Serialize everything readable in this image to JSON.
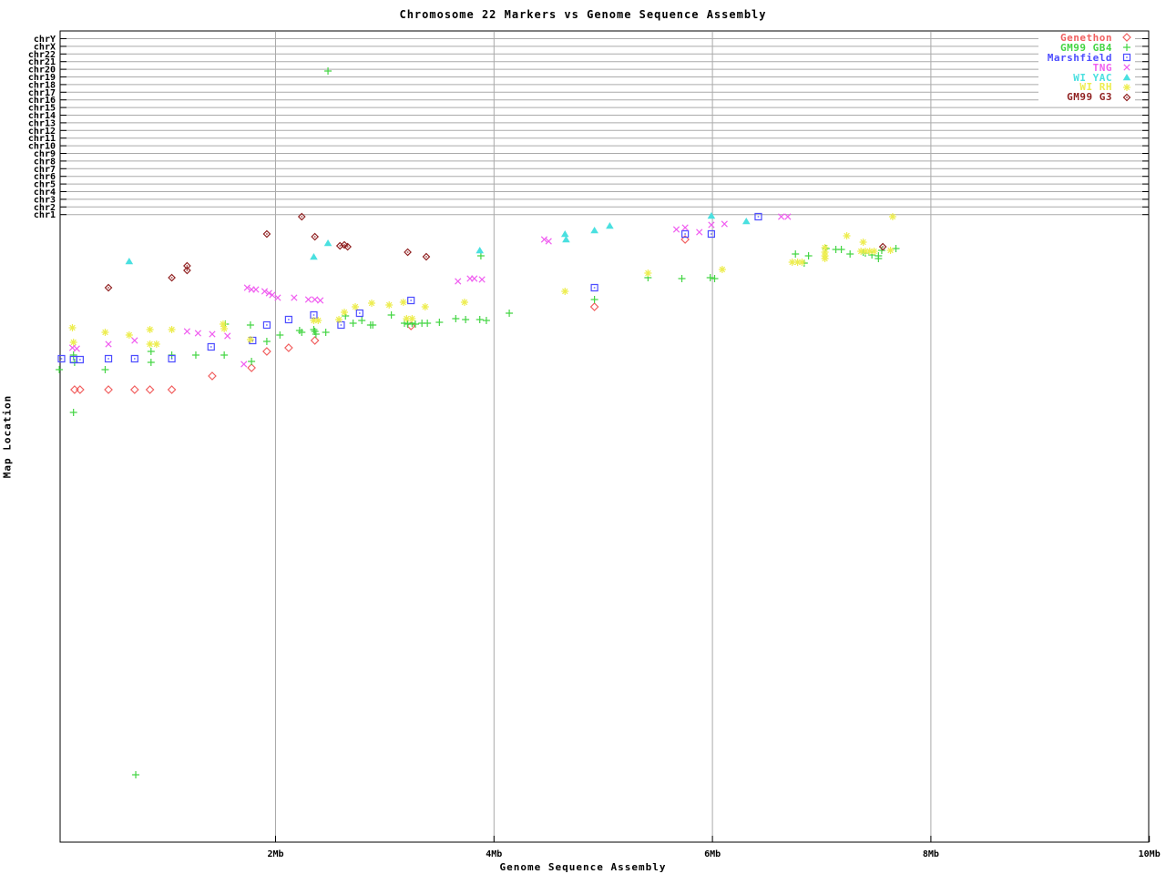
{
  "title": "Chromosome 22 Markers vs Genome Sequence Assembly",
  "x_axis": {
    "label": "Genome Sequence Assembly",
    "tick_labels": [
      "2Mb",
      "4Mb",
      "6Mb",
      "8Mb",
      "10Mb"
    ],
    "tick_values": [
      2,
      4,
      6,
      8,
      10
    ],
    "range_mb": [
      0,
      10
    ]
  },
  "y_axis": {
    "label": "Map Location",
    "categories": [
      "chrY",
      "chrX",
      "chr22",
      "chr21",
      "chr20",
      "chr19",
      "chr18",
      "chr17",
      "chr16",
      "chr15",
      "chr14",
      "chr13",
      "chr12",
      "chr11",
      "chr10",
      "chr9",
      "chr8",
      "chr7",
      "chr6",
      "chr5",
      "chr4",
      "chr3",
      "chr2",
      "chr1"
    ]
  },
  "colors": {
    "grid": "#aaaaaa",
    "frame": "#000000",
    "background": "#ffffff"
  },
  "chart_data": {
    "type": "scatter",
    "title": "Chromosome 22 Markers vs Genome Sequence Assembly",
    "xlabel": "Genome Sequence Assembly",
    "ylabel": "Map Location",
    "xlim_mb": [
      0,
      10
    ],
    "x_ticks": [
      "2Mb",
      "4Mb",
      "6Mb",
      "8Mb",
      "10Mb"
    ],
    "y_categories": [
      "chrY",
      "chrX",
      "chr22",
      "chr21",
      "chr20",
      "chr19",
      "chr18",
      "chr17",
      "chr16",
      "chr15",
      "chr14",
      "chr13",
      "chr12",
      "chr11",
      "chr10",
      "chr9",
      "chr8",
      "chr7",
      "chr6",
      "chr5",
      "chr4",
      "chr3",
      "chr2",
      "chr1"
    ],
    "grid": true,
    "legend_position": "top-right",
    "y_note": "x in Mb read from axis; y is vertical screen position (map-location axis shows only chromosome ticks at top, chr1 line = 236)",
    "series": [
      {
        "name": "Genethon",
        "color": "#f15f5f",
        "marker": "open-diamond",
        "points": [
          [
            0.16,
            428
          ],
          [
            0.21,
            428
          ],
          [
            0.47,
            428
          ],
          [
            0.71,
            428
          ],
          [
            0.85,
            428
          ],
          [
            1.05,
            428
          ],
          [
            1.42,
            413
          ],
          [
            1.78,
            404
          ],
          [
            1.92,
            386
          ],
          [
            2.12,
            382
          ],
          [
            2.36,
            374
          ],
          [
            3.24,
            358
          ],
          [
            4.92,
            337
          ],
          [
            5.75,
            263
          ]
        ]
      },
      {
        "name": "GM99 GB4",
        "color": "#44d544",
        "marker": "plus",
        "points": [
          [
            2.48,
            78
          ],
          [
            0.72,
            851
          ],
          [
            0.02,
            406
          ],
          [
            0.15,
            390
          ],
          [
            0.16,
            398
          ],
          [
            0.15,
            453
          ],
          [
            0.44,
            406
          ],
          [
            0.86,
            386
          ],
          [
            0.86,
            398
          ],
          [
            1.05,
            390
          ],
          [
            1.27,
            390
          ],
          [
            1.53,
            390
          ],
          [
            1.54,
            356
          ],
          [
            1.77,
            357
          ],
          [
            1.78,
            397
          ],
          [
            1.92,
            375
          ],
          [
            2.04,
            368
          ],
          [
            2.22,
            363
          ],
          [
            2.24,
            365
          ],
          [
            2.35,
            362
          ],
          [
            2.36,
            364
          ],
          [
            2.37,
            367
          ],
          [
            2.46,
            365
          ],
          [
            2.64,
            347
          ],
          [
            2.71,
            355
          ],
          [
            2.79,
            352
          ],
          [
            2.87,
            357
          ],
          [
            2.89,
            357
          ],
          [
            3.06,
            346
          ],
          [
            3.18,
            355
          ],
          [
            3.21,
            356
          ],
          [
            3.25,
            355
          ],
          [
            3.28,
            356
          ],
          [
            3.34,
            355
          ],
          [
            3.39,
            355
          ],
          [
            3.5,
            354
          ],
          [
            3.65,
            350
          ],
          [
            3.74,
            351
          ],
          [
            3.87,
            351
          ],
          [
            3.93,
            352
          ],
          [
            4.14,
            344
          ],
          [
            3.88,
            281
          ],
          [
            4.92,
            329
          ],
          [
            5.41,
            305
          ],
          [
            5.72,
            306
          ],
          [
            5.98,
            305
          ],
          [
            6.02,
            306
          ],
          [
            6.76,
            279
          ],
          [
            6.84,
            289
          ],
          [
            6.88,
            281
          ],
          [
            7.04,
            273
          ],
          [
            7.13,
            274
          ],
          [
            7.18,
            274
          ],
          [
            7.26,
            279
          ],
          [
            7.38,
            277
          ],
          [
            7.4,
            278
          ],
          [
            7.46,
            280
          ],
          [
            7.52,
            281
          ],
          [
            7.52,
            284
          ],
          [
            7.55,
            275
          ],
          [
            7.68,
            273
          ]
        ]
      },
      {
        "name": "Marshfield",
        "color": "#4d4dff",
        "marker": "square-dot",
        "points": [
          [
            0.04,
            394
          ],
          [
            0.15,
            395
          ],
          [
            0.21,
            395
          ],
          [
            0.47,
            394
          ],
          [
            0.71,
            394
          ],
          [
            1.05,
            394
          ],
          [
            1.41,
            381
          ],
          [
            1.79,
            374
          ],
          [
            1.92,
            357
          ],
          [
            2.12,
            351
          ],
          [
            2.35,
            346
          ],
          [
            2.6,
            357
          ],
          [
            2.77,
            344
          ],
          [
            3.24,
            330
          ],
          [
            4.92,
            316
          ],
          [
            5.75,
            257
          ],
          [
            5.99,
            257
          ],
          [
            6.42,
            238
          ]
        ]
      },
      {
        "name": "TNG",
        "color": "#f05ef0",
        "marker": "x-cross",
        "points": [
          [
            0.14,
            382
          ],
          [
            0.18,
            383
          ],
          [
            0.47,
            378
          ],
          [
            0.71,
            374
          ],
          [
            1.19,
            364
          ],
          [
            1.29,
            366
          ],
          [
            1.42,
            367
          ],
          [
            1.56,
            369
          ],
          [
            1.71,
            400
          ],
          [
            1.74,
            316
          ],
          [
            1.78,
            318
          ],
          [
            1.82,
            318
          ],
          [
            1.9,
            320
          ],
          [
            1.94,
            322
          ],
          [
            1.97,
            324
          ],
          [
            2.02,
            327
          ],
          [
            2.17,
            327
          ],
          [
            2.3,
            329
          ],
          [
            2.36,
            329
          ],
          [
            2.41,
            330
          ],
          [
            3.67,
            309
          ],
          [
            3.78,
            306
          ],
          [
            3.82,
            306
          ],
          [
            3.89,
            307
          ],
          [
            4.46,
            263
          ],
          [
            4.5,
            265
          ],
          [
            5.67,
            252
          ],
          [
            5.75,
            250
          ],
          [
            5.88,
            255
          ],
          [
            5.99,
            247
          ],
          [
            6.11,
            246
          ],
          [
            6.63,
            238
          ],
          [
            6.69,
            238
          ]
        ]
      },
      {
        "name": "WI YAC",
        "color": "#4ae0e0",
        "marker": "triangle",
        "points": [
          [
            0.66,
            287
          ],
          [
            2.35,
            282
          ],
          [
            2.48,
            267
          ],
          [
            3.87,
            275
          ],
          [
            4.65,
            257
          ],
          [
            4.66,
            263
          ],
          [
            4.92,
            253
          ],
          [
            5.06,
            248
          ],
          [
            5.99,
            237
          ],
          [
            6.31,
            243
          ]
        ]
      },
      {
        "name": "WI RH",
        "color": "#eded50",
        "marker": "asterisk",
        "points": [
          [
            0.14,
            360
          ],
          [
            0.15,
            376
          ],
          [
            0.44,
            365
          ],
          [
            0.66,
            368
          ],
          [
            0.85,
            362
          ],
          [
            0.85,
            378
          ],
          [
            0.91,
            378
          ],
          [
            1.05,
            362
          ],
          [
            1.52,
            356
          ],
          [
            1.53,
            361
          ],
          [
            1.77,
            373
          ],
          [
            2.35,
            352
          ],
          [
            2.39,
            352
          ],
          [
            2.58,
            351
          ],
          [
            2.63,
            343
          ],
          [
            2.73,
            337
          ],
          [
            2.88,
            333
          ],
          [
            3.04,
            335
          ],
          [
            3.17,
            332
          ],
          [
            3.2,
            350
          ],
          [
            3.25,
            350
          ],
          [
            3.37,
            337
          ],
          [
            3.73,
            332
          ],
          [
            4.65,
            320
          ],
          [
            5.41,
            300
          ],
          [
            6.09,
            296
          ],
          [
            6.73,
            288
          ],
          [
            6.78,
            288
          ],
          [
            6.82,
            288
          ],
          [
            7.03,
            272
          ],
          [
            7.03,
            277
          ],
          [
            7.03,
            281
          ],
          [
            7.03,
            284
          ],
          [
            7.23,
            259
          ],
          [
            7.36,
            276
          ],
          [
            7.38,
            266
          ],
          [
            7.4,
            276
          ],
          [
            7.44,
            276
          ],
          [
            7.48,
            276
          ],
          [
            7.63,
            275
          ],
          [
            7.65,
            238
          ]
        ]
      },
      {
        "name": "GM99 G3",
        "color": "#8f1f1f",
        "marker": "diamond-dot",
        "points": [
          [
            0.47,
            316
          ],
          [
            1.05,
            305
          ],
          [
            1.19,
            292
          ],
          [
            1.19,
            297
          ],
          [
            1.92,
            257
          ],
          [
            2.24,
            238
          ],
          [
            2.36,
            260
          ],
          [
            2.59,
            270
          ],
          [
            2.63,
            269
          ],
          [
            2.66,
            271
          ],
          [
            3.21,
            277
          ],
          [
            3.38,
            282
          ],
          [
            7.56,
            271
          ]
        ]
      }
    ]
  }
}
